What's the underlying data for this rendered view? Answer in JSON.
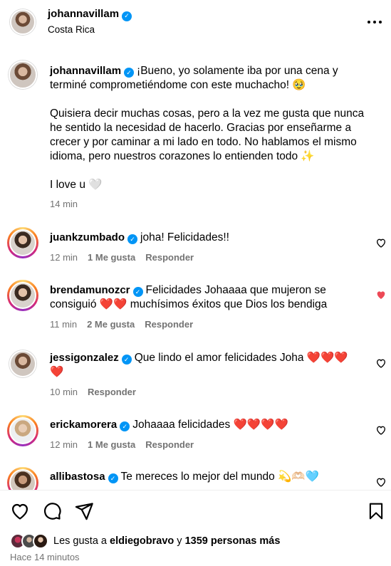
{
  "header": {
    "username": "johannavillam",
    "location": "Costa Rica",
    "more_icon": "more-horizontal-icon"
  },
  "caption": {
    "username": "johannavillam",
    "line1": "¡Bueno, yo solamente iba por una cena y terminé comprometiéndome con este muchacho! 🥹",
    "para2": "Quisiera decir muchas cosas, pero a la vez me gusta que nunca he sentido la necesidad de hacerlo. Gracias por enseñarme a crecer y por caminar a mi lado en todo. No hablamos el mismo idioma, pero nuestros corazones lo entienden todo ✨",
    "para3": "I love u 🤍",
    "time": "14 min"
  },
  "comments": [
    {
      "username": "juankzumbado",
      "text": "joha! Felicidades!!",
      "time": "12 min",
      "likes": "1 Me gusta",
      "reply": "Responder",
      "liked": false
    },
    {
      "username": "brendamunozcr",
      "text": "Felicidades Johaaaa que mujeron se consiguió ❤️❤️ muchísimos éxitos que Dios los bendiga",
      "time": "11 min",
      "likes": "2 Me gusta",
      "reply": "Responder",
      "liked": true
    },
    {
      "username": "jessigonzalez",
      "text": "Que lindo el amor felicidades Joha ❤️❤️❤️ ❤️",
      "time": "10 min",
      "likes": "",
      "reply": "Responder",
      "liked": false
    },
    {
      "username": "erickamorera",
      "text": "Johaaaa felicidades ❤️❤️❤️❤️",
      "time": "12 min",
      "likes": "1 Me gusta",
      "reply": "Responder",
      "liked": false
    },
    {
      "username": "allibastosa",
      "text": "Te mereces lo mejor del mundo 💫🫶🏻🩵",
      "time": "",
      "likes": "",
      "reply": "",
      "liked": false
    }
  ],
  "actions": {
    "like_icon": "heart-icon",
    "comment_icon": "comment-icon",
    "share_icon": "send-icon",
    "save_icon": "bookmark-icon"
  },
  "likes": {
    "prefix": "Les gusta a",
    "user": "eldiegobravo",
    "conj": "y",
    "others": "1359 personas más"
  },
  "posted": "Hace 14 minutos",
  "colors": {
    "accent": "#0095f6",
    "liked": "#ed4956",
    "meta": "#737373"
  }
}
